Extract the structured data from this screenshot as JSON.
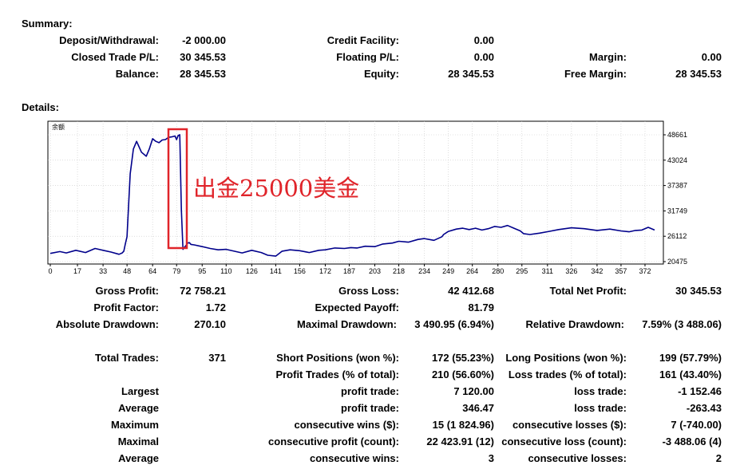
{
  "summary": {
    "heading": "Summary:",
    "deposit_withdrawal": {
      "label": "Deposit/Withdrawal:",
      "value": "-2 000.00"
    },
    "credit_facility": {
      "label": "Credit Facility:",
      "value": "0.00"
    },
    "closed_trade_pl": {
      "label": "Closed Trade P/L:",
      "value": "30 345.53"
    },
    "floating_pl": {
      "label": "Floating P/L:",
      "value": "0.00"
    },
    "margin": {
      "label": "Margin:",
      "value": "0.00"
    },
    "balance": {
      "label": "Balance:",
      "value": "28 345.53"
    },
    "equity": {
      "label": "Equity:",
      "value": "28 345.53"
    },
    "free_margin": {
      "label": "Free Margin:",
      "value": "28 345.53"
    }
  },
  "details": {
    "heading": "Details:",
    "chart_title": "余额",
    "annotation": "出金25000美金"
  },
  "chart_data": {
    "type": "line",
    "title": "余额",
    "x_ticks": [
      "0",
      "17",
      "33",
      "48",
      "64",
      "79",
      "95",
      "110",
      "126",
      "141",
      "156",
      "172",
      "187",
      "203",
      "218",
      "234",
      "249",
      "264",
      "280",
      "295",
      "311",
      "326",
      "342",
      "357",
      "372"
    ],
    "y_ticks": [
      "48661",
      "43024",
      "37387",
      "31749",
      "26112",
      "20475"
    ],
    "xlim": [
      0,
      378
    ],
    "ylim": [
      20475,
      48661
    ],
    "series": [
      {
        "color": "#00008b",
        "x": [
          0,
          6,
          10,
          16,
          22,
          28,
          33,
          38,
          43,
          45,
          46,
          47,
          48,
          49,
          50,
          52,
          54,
          57,
          60,
          62,
          64,
          66,
          68,
          70,
          72,
          74,
          76,
          78,
          79,
          80,
          81,
          82,
          83,
          84,
          85,
          86,
          87,
          88,
          90,
          95,
          100,
          105,
          110,
          115,
          120,
          126,
          132,
          136,
          141,
          145,
          150,
          156,
          162,
          168,
          172,
          178,
          184,
          188,
          192,
          197,
          203,
          208,
          214,
          218,
          224,
          230,
          234,
          240,
          245,
          246,
          249,
          254,
          258,
          262,
          266,
          270,
          274,
          278,
          282,
          286,
          290,
          294,
          296,
          300,
          306,
          312,
          318,
          326,
          334,
          342,
          350,
          357,
          362,
          366,
          370,
          374,
          378
        ],
        "y": [
          22300,
          22700,
          22400,
          23000,
          22500,
          23400,
          23000,
          22600,
          22100,
          22400,
          22800,
          24500,
          26000,
          33000,
          40000,
          45500,
          47200,
          44800,
          43900,
          45600,
          47800,
          47200,
          46900,
          47500,
          47600,
          48100,
          48200,
          48400,
          47600,
          48500,
          48661,
          32000,
          23200,
          23700,
          24100,
          24600,
          24700,
          24300,
          24200,
          23800,
          23400,
          23100,
          23200,
          22800,
          22400,
          23000,
          22500,
          21900,
          21700,
          22800,
          23100,
          22900,
          22500,
          23000,
          23100,
          23500,
          23400,
          23600,
          23500,
          23900,
          23800,
          24400,
          24600,
          25000,
          24800,
          25400,
          25600,
          25200,
          26000,
          26500,
          27200,
          27700,
          27900,
          27600,
          27900,
          27500,
          27800,
          28300,
          28100,
          28500,
          27900,
          27300,
          26700,
          26500,
          26800,
          27200,
          27600,
          28000,
          27800,
          27400,
          27700,
          27300,
          27100,
          27400,
          27500,
          28100,
          27500
        ]
      }
    ]
  },
  "stats": {
    "gross_profit": {
      "label": "Gross Profit:",
      "value": "72 758.21"
    },
    "gross_loss": {
      "label": "Gross Loss:",
      "value": "42 412.68"
    },
    "total_net_profit": {
      "label": "Total Net Profit:",
      "value": "30 345.53"
    },
    "profit_factor": {
      "label": "Profit Factor:",
      "value": "1.72"
    },
    "expected_payoff": {
      "label": "Expected Payoff:",
      "value": "81.79"
    },
    "absolute_drawdown": {
      "label": "Absolute Drawdown:",
      "value": "270.10"
    },
    "maximal_drawdown": {
      "label": "Maximal Drawdown:",
      "value": "3 490.95 (6.94%)"
    },
    "relative_drawdown": {
      "label": "Relative Drawdown:",
      "value": "7.59% (3 488.06)"
    },
    "total_trades": {
      "label": "Total Trades:",
      "value": "371"
    },
    "short_positions": {
      "label": "Short Positions (won %):",
      "value": "172 (55.23%)"
    },
    "long_positions": {
      "label": "Long Positions (won %):",
      "value": "199 (57.79%)"
    },
    "profit_trades": {
      "label": "Profit Trades (% of total):",
      "value": "210 (56.60%)"
    },
    "loss_trades": {
      "label": "Loss trades (% of total):",
      "value": "161 (43.40%)"
    },
    "largest": {
      "label": "Largest",
      "profit_label": "profit trade:",
      "profit_value": "7 120.00",
      "loss_label": "loss trade:",
      "loss_value": "-1 152.46"
    },
    "average": {
      "label": "Average",
      "profit_label": "profit trade:",
      "profit_value": "346.47",
      "loss_label": "loss trade:",
      "loss_value": "-263.43"
    },
    "maximum": {
      "label": "Maximum",
      "profit_label": "consecutive wins ($):",
      "profit_value": "15 (1 824.96)",
      "loss_label": "consecutive losses ($):",
      "loss_value": "7 (-740.00)"
    },
    "maximal": {
      "label": "Maximal",
      "profit_label": "consecutive profit (count):",
      "profit_value": "22 423.91 (12)",
      "loss_label": "consecutive loss (count):",
      "loss_value": "-3 488.06 (4)"
    },
    "average_consec": {
      "label": "Average",
      "profit_label": "consecutive wins:",
      "profit_value": "3",
      "loss_label": "consecutive losses:",
      "loss_value": "2"
    }
  },
  "colors": {
    "line": "#00008b",
    "annotation": "#e0242a",
    "grid": "#c8c8c8"
  }
}
